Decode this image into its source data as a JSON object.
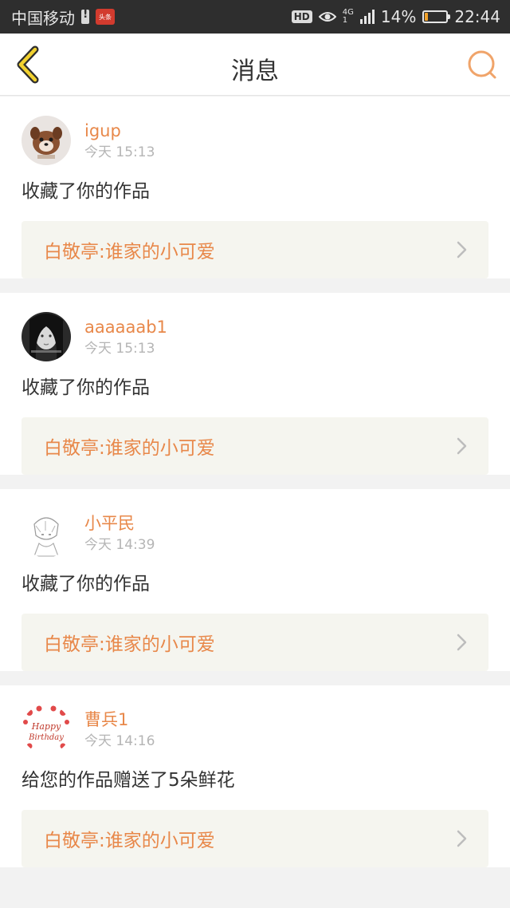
{
  "status_bar": {
    "carrier": "中国移动",
    "app_icon_text": "头条",
    "hd": "HD",
    "network": "4G",
    "network_sub": "1",
    "battery": "14%",
    "battery_level": 0.14,
    "time": "22:44"
  },
  "header": {
    "title": "消息",
    "back_icon": "chevron-left-icon",
    "search_icon": "search-icon"
  },
  "messages": [
    {
      "user": "igup",
      "time": "今天 15:13",
      "action": "收藏了你的作品",
      "work": "白敬亭:谁家的小可爱",
      "avatar": "dog-avatar"
    },
    {
      "user": "aaaaaab1",
      "time": "今天 15:13",
      "action": "收藏了你的作品",
      "work": "白敬亭:谁家的小可爱",
      "avatar": "girl-avatar"
    },
    {
      "user": "小平民",
      "time": "今天 14:39",
      "action": "收藏了你的作品",
      "work": "白敬亭:谁家的小可爱",
      "avatar": "sketch-avatar"
    },
    {
      "user": "曹兵1",
      "time": "今天 14:16",
      "action": "给您的作品赠送了5朵鲜花",
      "work": "白敬亭:谁家的小可爱",
      "avatar": "birthday-avatar",
      "avatar_text": "Happy Birthday"
    }
  ],
  "colors": {
    "accent": "#e8884a",
    "status_bar_bg": "#2e2e2e",
    "link_bg": "#f5f5ef",
    "page_bg": "#f2f2f2"
  }
}
